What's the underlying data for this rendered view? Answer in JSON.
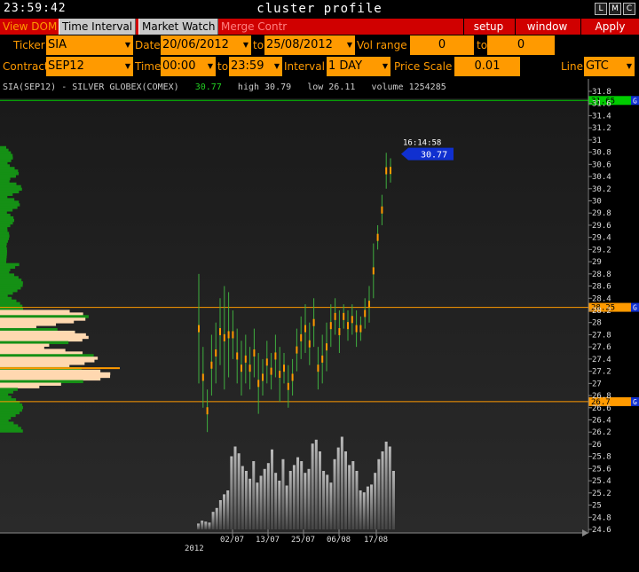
{
  "window": {
    "clock": "23:59:42",
    "title": "cluster profile",
    "buttons": [
      "L",
      "M",
      "C"
    ]
  },
  "menubar": {
    "view_dom": "View DOM",
    "time_interval": "Time Interval",
    "market_watch": "Market Watch",
    "merge_contr": "Merge Contr",
    "setup": "setup",
    "window": "window",
    "apply": "Apply"
  },
  "controls": {
    "ticker_label": "Ticker",
    "ticker_value": "SIA",
    "date_label": "Date",
    "date_from": "20/06/2012",
    "to_label": "to",
    "date_to": "25/08/2012",
    "vol_range_label": "Vol range",
    "vol_from": "0",
    "vol_to_label": "to",
    "vol_to": "0",
    "contract_label": "Contract",
    "contract_value": "SEP12",
    "time_label": "Time",
    "time_from": "00:00",
    "time_to_label": "to",
    "time_to": "23:59",
    "interval_label": "Interval",
    "interval_value": "1 DAY",
    "price_scale_label": "Price Scale",
    "price_scale_value": "0.01",
    "line_label": "Line",
    "line_value": "GTC"
  },
  "info": {
    "symbol": "SIA(SEP12) - SILVER GLOBEX(COMEX)",
    "last": "30.77",
    "high": "high 30.79",
    "low": "low 26.11",
    "volume": "volume 1254285"
  },
  "colors": {
    "accent_orange": "#ff9a00",
    "menu_red": "#d00000",
    "green_line": "#00cc00",
    "price_tag_blue": "#1030d0"
  },
  "chart_data": {
    "type": "line",
    "title": "SIA(SEP12) - SILVER GLOBEX(COMEX)",
    "y_ticks": [
      "31.8",
      "31.6",
      "31.4",
      "31.2",
      "31",
      "30.8",
      "30.6",
      "30.4",
      "30.2",
      "30",
      "29.8",
      "29.6",
      "29.4",
      "29.2",
      "29",
      "28.8",
      "28.6",
      "28.4",
      "28.2",
      "28",
      "27.8",
      "27.6",
      "27.4",
      "27.2",
      "27",
      "26.8",
      "26.6",
      "26.4",
      "26.2",
      "26",
      "25.8",
      "25.6",
      "25.4",
      "25.2",
      "25",
      "24.8",
      "24.6"
    ],
    "ylim": [
      24.6,
      31.8
    ],
    "x_labels": [
      "2012",
      "02/07",
      "13/07",
      "25/07",
      "06/08",
      "17/08"
    ],
    "last_time": "16:14:58",
    "last_price": "30.77",
    "levels": [
      {
        "name": "green-level",
        "price": 31.65,
        "label": "31.65",
        "tag": "G",
        "color": "#00cc00"
      },
      {
        "name": "orange-level-upper",
        "price": 28.25,
        "label": "28.25",
        "tag": "G",
        "color": "#ff9a00"
      },
      {
        "name": "orange-level-lower",
        "price": 26.7,
        "label": "26.7",
        "tag": "G",
        "color": "#ff9a00"
      }
    ],
    "volume_bars": [
      6,
      9,
      8,
      7,
      18,
      22,
      30,
      36,
      40,
      75,
      85,
      78,
      65,
      60,
      52,
      70,
      48,
      55,
      62,
      68,
      82,
      58,
      50,
      72,
      45,
      60,
      66,
      74,
      70,
      58,
      62,
      88,
      92,
      80,
      60,
      56,
      48,
      72,
      84,
      95,
      80,
      66,
      70,
      60,
      40,
      38,
      44,
      46,
      58,
      72,
      80,
      90,
      85,
      60
    ],
    "price_bars": [
      {
        "lo": 27.0,
        "hi": 28.8
      },
      {
        "lo": 26.6,
        "hi": 27.6
      },
      {
        "lo": 26.2,
        "hi": 26.9
      },
      {
        "lo": 26.8,
        "hi": 27.8
      },
      {
        "lo": 27.0,
        "hi": 28.0
      },
      {
        "lo": 27.3,
        "hi": 28.4
      },
      {
        "lo": 26.9,
        "hi": 28.6
      },
      {
        "lo": 27.1,
        "hi": 28.5
      },
      {
        "lo": 27.4,
        "hi": 28.2
      },
      {
        "lo": 27.0,
        "hi": 27.9
      },
      {
        "lo": 26.8,
        "hi": 27.7
      },
      {
        "lo": 27.0,
        "hi": 27.8
      },
      {
        "lo": 26.9,
        "hi": 27.6
      },
      {
        "lo": 27.1,
        "hi": 27.9
      },
      {
        "lo": 26.5,
        "hi": 27.5
      },
      {
        "lo": 26.8,
        "hi": 27.4
      },
      {
        "lo": 27.0,
        "hi": 27.7
      },
      {
        "lo": 26.9,
        "hi": 27.5
      },
      {
        "lo": 27.1,
        "hi": 27.8
      },
      {
        "lo": 26.7,
        "hi": 27.6
      },
      {
        "lo": 27.0,
        "hi": 27.5
      },
      {
        "lo": 26.6,
        "hi": 27.3
      },
      {
        "lo": 26.8,
        "hi": 27.4
      },
      {
        "lo": 27.2,
        "hi": 27.9
      },
      {
        "lo": 27.4,
        "hi": 28.1
      },
      {
        "lo": 27.5,
        "hi": 28.3
      },
      {
        "lo": 27.3,
        "hi": 28.0
      },
      {
        "lo": 27.6,
        "hi": 28.4
      },
      {
        "lo": 26.9,
        "hi": 27.6
      },
      {
        "lo": 27.0,
        "hi": 27.8
      },
      {
        "lo": 27.2,
        "hi": 28.0
      },
      {
        "lo": 27.6,
        "hi": 28.3
      },
      {
        "lo": 27.8,
        "hi": 28.4
      },
      {
        "lo": 27.5,
        "hi": 28.2
      },
      {
        "lo": 27.9,
        "hi": 28.3
      },
      {
        "lo": 27.7,
        "hi": 28.2
      },
      {
        "lo": 27.8,
        "hi": 28.3
      },
      {
        "lo": 27.6,
        "hi": 28.2
      },
      {
        "lo": 27.7,
        "hi": 28.1
      },
      {
        "lo": 27.9,
        "hi": 28.4
      },
      {
        "lo": 28.0,
        "hi": 28.6
      },
      {
        "lo": 28.4,
        "hi": 29.3
      },
      {
        "lo": 29.2,
        "hi": 29.6
      },
      {
        "lo": 29.6,
        "hi": 30.1
      },
      {
        "lo": 30.2,
        "hi": 30.79
      },
      {
        "lo": 30.3,
        "hi": 30.7
      }
    ]
  }
}
